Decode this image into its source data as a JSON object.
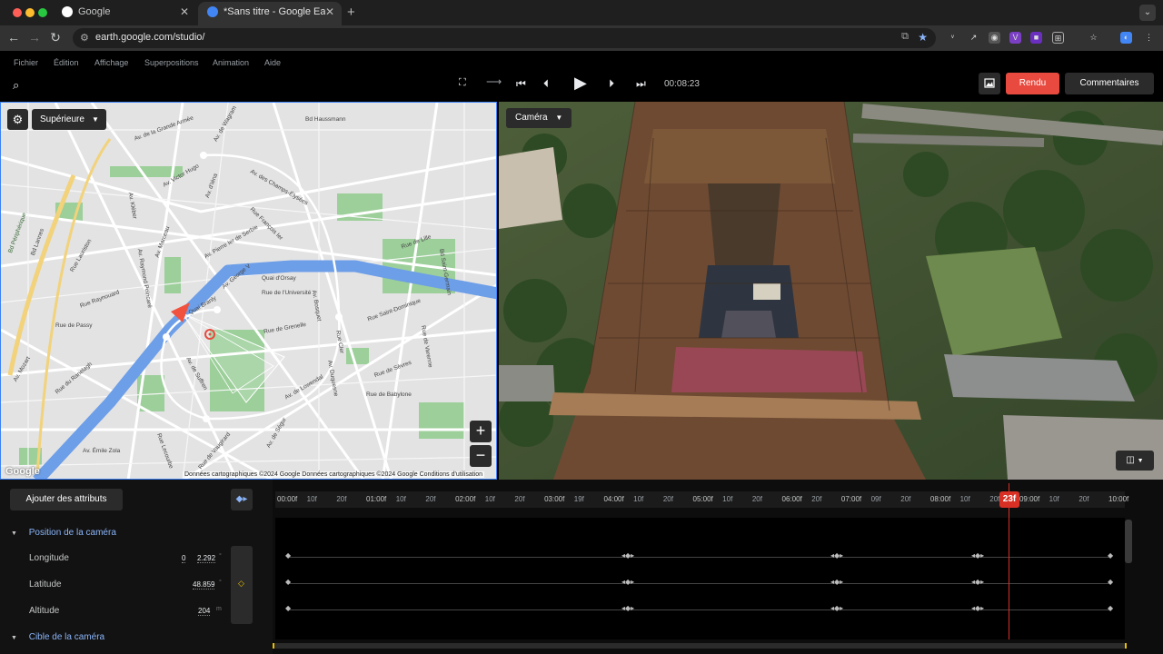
{
  "browser": {
    "tabs": [
      {
        "title": "Google",
        "active": false
      },
      {
        "title": "*Sans titre - Google Earth St",
        "active": true
      }
    ],
    "url": "earth.google.com/studio/"
  },
  "menu": [
    "Fichier",
    "Édition",
    "Affichage",
    "Superpositions",
    "Animation",
    "Aide"
  ],
  "toolbar": {
    "timecode": "00:08:23",
    "render_label": "Rendu",
    "comments_label": "Commentaires"
  },
  "map": {
    "view_label": "Supérieure",
    "attribution": "Données cartographiques ©2024 Google  Données cartographiques ©2024 Google  Conditions d'utilisation",
    "logo": "Google",
    "zoom_in": "+",
    "zoom_out": "−",
    "streets": [
      "Av. de la Grande Armée",
      "Av. de Wagram",
      "Bd Haussmann",
      "Av. Victor Hugo",
      "Av. d'Iéna",
      "Av. des Champs-Élysées",
      "Av. Kléber",
      "Rue Lauriston",
      "Av. Pierre Ier de Serbie",
      "Av. Marceau",
      "Av. Raymond Poincaré",
      "Av. George V",
      "Rue François Ier",
      "Quai d'Orsay",
      "Rue de l'Université",
      "Rue Saint-Dominique",
      "Rue de Grenelle",
      "Rue de Passy",
      "Rue Raynouard",
      "Rue de Lille",
      "Bd Saint-Germain",
      "Av. Mozart",
      "Rue du Ranelagh",
      "Av. Émile Zola",
      "Rue de Sèvres",
      "Rue de Babylone",
      "Av. de Suffren",
      "Av. de Lowendal",
      "Av. de Ségur",
      "Rue de Vaugirard",
      "Rue Lecourbe",
      "Bd Périphérique",
      "Bd Lannes",
      "Quai Branly",
      "Av. Bosquet",
      "Av. Duquesne",
      "Rue de Varenne",
      "Rue Cler"
    ]
  },
  "camera": {
    "label": "Caméra"
  },
  "timeline": {
    "add_attributes": "Ajouter des attributs",
    "section": "Position de la caméra",
    "next_section": "Cible de la caméra",
    "playhead": "23f",
    "rows": [
      {
        "name": "Longitude",
        "deg": "0",
        "value": "2.292",
        "unit": "°"
      },
      {
        "name": "Latitude",
        "deg": "",
        "value": "48.859",
        "unit": "°"
      },
      {
        "name": "Altitude",
        "deg": "",
        "value": "204",
        "unit": "m"
      }
    ],
    "ruler": [
      "00:00f",
      "10f",
      "20f",
      "01:00f",
      "10f",
      "20f",
      "02:00f",
      "10f",
      "20f",
      "03:00f",
      "19f",
      "04:00f",
      "10f",
      "20f",
      "05:00f",
      "10f",
      "20f",
      "06:00f",
      "20f",
      "07:00f",
      "09f",
      "20f",
      "08:00f",
      "10f",
      "20f",
      "09:00f",
      "10f",
      "20f",
      "10:00f"
    ]
  },
  "colors": {
    "render": "#e84a3f",
    "accent": "#8ab4f8",
    "playhead": "#d93025"
  }
}
